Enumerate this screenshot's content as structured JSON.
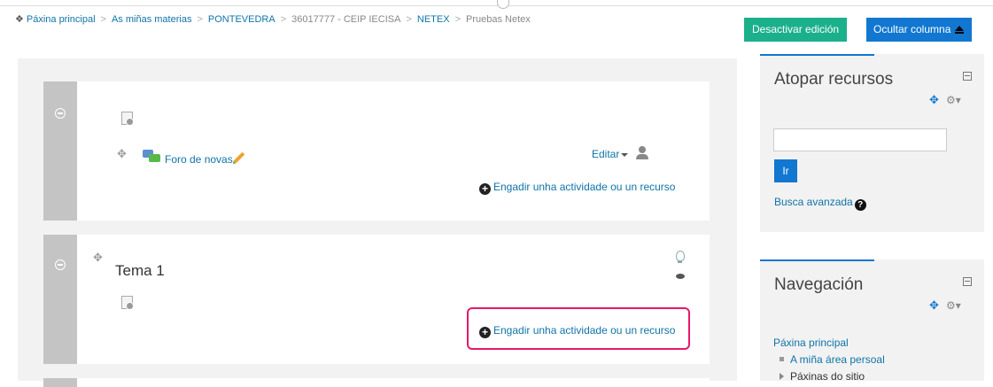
{
  "breadcrumb": [
    {
      "label": "Páxina principal"
    },
    {
      "label": "As miñas materias"
    },
    {
      "label": "PONTEVEDRA"
    },
    {
      "label": "36017777 - CEIP IECISA"
    },
    {
      "label": "NETEX"
    },
    {
      "label": "Pruebas Netex"
    }
  ],
  "header": {
    "edit_mode_label": "Desactivar edición",
    "hide_column_label": "Ocultar columna"
  },
  "sections": [
    {
      "forum_label": "Foro de novas",
      "edit_label": "Editar",
      "add_label": "Engadir unha actividade ou un recurso"
    },
    {
      "title": "Tema 1",
      "add_label": "Engadir unha actividade ou un recurso"
    }
  ],
  "search_block": {
    "title": "Atopar recursos",
    "go_label": "Ir",
    "advanced_label": "Busca avanzada"
  },
  "nav_block": {
    "title": "Navegación",
    "home_label": "Páxina principal",
    "items": [
      {
        "label": "A miña área persoal"
      },
      {
        "label": "Páxinas do sitio"
      }
    ]
  },
  "colors": {
    "edit_button": "#1bb08c",
    "primary": "#1177d1",
    "link": "#0f74a8",
    "highlight": "#e8186a"
  }
}
